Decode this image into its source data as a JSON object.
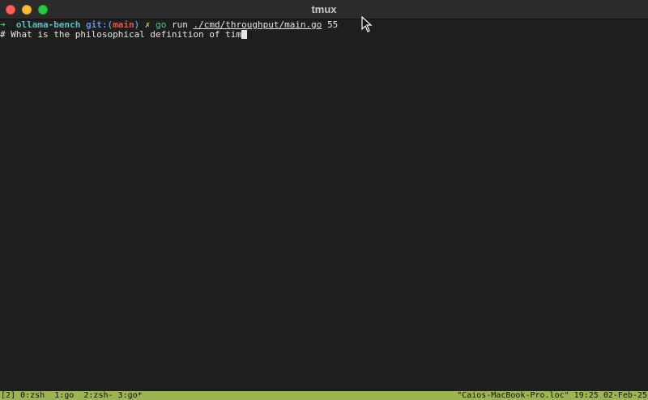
{
  "window": {
    "title": "tmux"
  },
  "prompt": {
    "arrow": "➜",
    "repo": "ollama-bench",
    "git_prefix": "git:(",
    "branch": "main",
    "git_suffix": ")",
    "dirty_mark": "✗",
    "command_go": "go",
    "command_run": "run",
    "command_path": "./cmd/throughput/main.go",
    "command_arg": "55"
  },
  "output": {
    "line1": "# What is the philosophical definition of tim"
  },
  "tmux_status": {
    "session": "[2]",
    "window0": "0:zsh",
    "window1": "1:go",
    "window2": "2:zsh-",
    "window3": "3:go*",
    "host": "\"Caios-MacBook-Pro.loc\"",
    "time": "19:25",
    "date": "02-Feb-25"
  },
  "colors": {
    "background": "#1e1e1e",
    "status_bar": "#9cb64f",
    "prompt_arrow": "#3fd07a",
    "repo": "#56c2c2",
    "branch": "#e05a4f"
  }
}
